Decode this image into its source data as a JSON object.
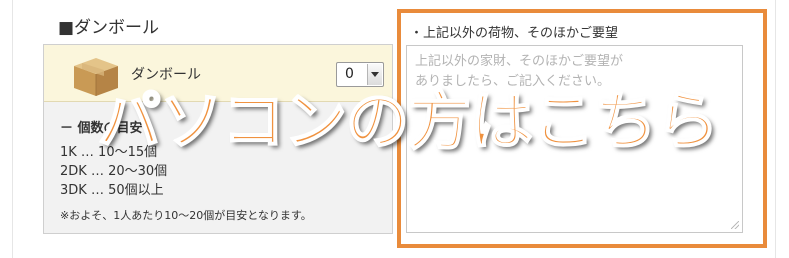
{
  "section_heading": "■ダンボール",
  "item": {
    "label": "ダンボール",
    "quantity": "0",
    "icon": "cardboard-box-icon"
  },
  "guide": {
    "title": "－ 個数の目安",
    "lines": [
      "1K … 10〜15個",
      "2DK … 20〜30個",
      "3DK … 50個以上"
    ],
    "note": "※およそ、1人あたり10〜20個が目安となります。"
  },
  "request": {
    "title": "・上記以外の荷物、そのほかご要望",
    "placeholder": "上記以外の家財、そのほかご要望が\nありましたら、ご記入ください。"
  },
  "overlay_text": "パソコンの方はこちら",
  "colors": {
    "accent": "#e98b3b",
    "card_header_bg": "#fbf6dc",
    "card_bg": "#f2f2f2"
  }
}
